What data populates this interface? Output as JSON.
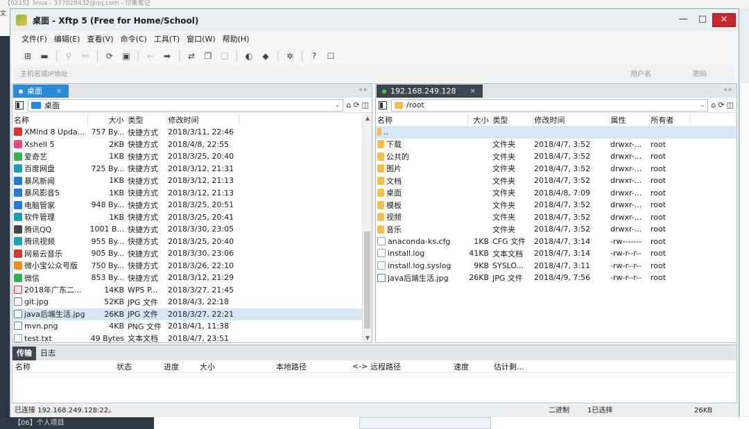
{
  "background": {
    "top_text": "【0215】linux - 377028432@qq.com - 印象笔记",
    "left_text": "文",
    "bottom_text": "【06】个人项目"
  },
  "window": {
    "title": "桌面   - Xftp 5 (Free for Home/School)",
    "controls": {
      "minimize": "—",
      "maximize": "□",
      "close": "✕"
    }
  },
  "menu": [
    "文件(F)",
    "编辑(E)",
    "查看(V)",
    "命令(C)",
    "工具(T)",
    "窗口(W)",
    "帮助(H)"
  ],
  "address": {
    "host_placeholder": "主机名或IP地址",
    "user_placeholder": "用户名",
    "password_placeholder": "密码"
  },
  "left_pane": {
    "tab_label": "桌面",
    "path": "桌面",
    "columns": [
      "名称",
      "大小",
      "类型",
      "修改时间"
    ],
    "rows": [
      {
        "name": "XMind 8 Upda...",
        "size": "757 By...",
        "type": "快捷方式",
        "time": "2018/3/11, 22:46",
        "icon": "red"
      },
      {
        "name": "Xshell 5",
        "size": "2KB",
        "type": "快捷方式",
        "time": "2018/4/8, 22:55",
        "icon": "pink"
      },
      {
        "name": "爱奇艺",
        "size": "1KB",
        "type": "快捷方式",
        "time": "2018/3/25, 20:40",
        "icon": "green"
      },
      {
        "name": "百度网盘",
        "size": "725 By...",
        "type": "快捷方式",
        "time": "2018/3/12, 21:31",
        "icon": "teal"
      },
      {
        "name": "暴风新闻",
        "size": "1KB",
        "type": "快捷方式",
        "time": "2018/3/12, 21:13",
        "icon": "blue"
      },
      {
        "name": "暴风影音5",
        "size": "1KB",
        "type": "快捷方式",
        "time": "2018/3/12, 21:13",
        "icon": "blue"
      },
      {
        "name": "电脑管家",
        "size": "948 By...",
        "type": "快捷方式",
        "time": "2018/3/25, 20:51",
        "icon": "blue"
      },
      {
        "name": "软件管理",
        "size": "1KB",
        "type": "快捷方式",
        "time": "2018/3/25, 20:41",
        "icon": "teal"
      },
      {
        "name": "腾讯QQ",
        "size": "1001 B...",
        "type": "快捷方式",
        "time": "2018/3/30, 23:05",
        "icon": "dark"
      },
      {
        "name": "腾讯视频",
        "size": "955 By...",
        "type": "快捷方式",
        "time": "2018/3/25, 20:40",
        "icon": "teal"
      },
      {
        "name": "网易云音乐",
        "size": "905 By...",
        "type": "快捷方式",
        "time": "2018/3/30, 23:06",
        "icon": "red"
      },
      {
        "name": "微小宝公众号版",
        "size": "750 By...",
        "type": "快捷方式",
        "time": "2018/3/26, 22:10",
        "icon": "orange"
      },
      {
        "name": "微信",
        "size": "853 By...",
        "type": "快捷方式",
        "time": "2018/3/12, 21:29",
        "icon": "green"
      },
      {
        "name": "2018年广东二...",
        "size": "14KB",
        "type": "WPS P...",
        "time": "2018/3/27, 21:45",
        "icon": "wps"
      },
      {
        "name": "git.jpg",
        "size": "52KB",
        "type": "JPG 文件",
        "time": "2018/4/3, 22:18",
        "icon": "img"
      },
      {
        "name": "java后端生活.jpg",
        "size": "26KB",
        "type": "JPG 文件",
        "time": "2018/3/27, 22:21",
        "icon": "img",
        "selected": true
      },
      {
        "name": "mvn.png",
        "size": "4KB",
        "type": "PNG 文件",
        "time": "2018/4/1, 11:38",
        "icon": "img"
      },
      {
        "name": "test.txt",
        "size": "49 Bytes",
        "type": "文本文档",
        "time": "2018/4/7, 23:51",
        "icon": "doc"
      }
    ]
  },
  "right_pane": {
    "tab_label": "192.168.249.128",
    "path": "/root",
    "columns": [
      "名称",
      "大小",
      "类型",
      "修改时间",
      "属性",
      "所有者"
    ],
    "rows": [
      {
        "name": "..",
        "size": "",
        "type": "",
        "time": "",
        "attr": "",
        "owner": "",
        "icon": "up",
        "selected": true
      },
      {
        "name": "下载",
        "size": "",
        "type": "文件夹",
        "time": "2018/4/7, 3:52",
        "attr": "drwxr-...",
        "owner": "root",
        "icon": "folder"
      },
      {
        "name": "公共的",
        "size": "",
        "type": "文件夹",
        "time": "2018/4/7, 3:52",
        "attr": "drwxr-...",
        "owner": "root",
        "icon": "folder"
      },
      {
        "name": "图片",
        "size": "",
        "type": "文件夹",
        "time": "2018/4/7, 3:52",
        "attr": "drwxr-...",
        "owner": "root",
        "icon": "folder"
      },
      {
        "name": "文档",
        "size": "",
        "type": "文件夹",
        "time": "2018/4/7, 3:52",
        "attr": "drwxr-...",
        "owner": "root",
        "icon": "folder"
      },
      {
        "name": "桌面",
        "size": "",
        "type": "文件夹",
        "time": "2018/4/8, 7:09",
        "attr": "drwxr-...",
        "owner": "root",
        "icon": "folder"
      },
      {
        "name": "模板",
        "size": "",
        "type": "文件夹",
        "time": "2018/4/7, 3:52",
        "attr": "drwxr-...",
        "owner": "root",
        "icon": "folder"
      },
      {
        "name": "视频",
        "size": "",
        "type": "文件夹",
        "time": "2018/4/7, 3:52",
        "attr": "drwxr-...",
        "owner": "root",
        "icon": "folder"
      },
      {
        "name": "音乐",
        "size": "",
        "type": "文件夹",
        "time": "2018/4/7, 3:52",
        "attr": "drwxr-...",
        "owner": "root",
        "icon": "folder"
      },
      {
        "name": "anaconda-ks.cfg",
        "size": "1KB",
        "type": "CFG 文件",
        "time": "2018/4/7, 3:14",
        "attr": "-rw-------",
        "owner": "root",
        "icon": "doc"
      },
      {
        "name": "install.log",
        "size": "41KB",
        "type": "文本文档",
        "time": "2018/4/7, 3:14",
        "attr": "-rw-r--r--",
        "owner": "root",
        "icon": "doc"
      },
      {
        "name": "install.log.syslog",
        "size": "9KB",
        "type": "SYSLO...",
        "time": "2018/4/7, 3:11",
        "attr": "-rw-r--r--",
        "owner": "root",
        "icon": "doc"
      },
      {
        "name": "java后端生活.jpg",
        "size": "26KB",
        "type": "JPG 文件",
        "time": "2018/4/9, 7:56",
        "attr": "-rw-r--r--",
        "owner": "root",
        "icon": "img"
      }
    ]
  },
  "transfer": {
    "tabs": [
      "传输",
      "日志"
    ],
    "columns": [
      "名称",
      "状态",
      "进度",
      "大小",
      "本地路径",
      "<->",
      "远程路径",
      "速度",
      "估计剩..."
    ]
  },
  "status": {
    "connection": "已连接 192.168.249.128:22。",
    "mode": "二进制",
    "selection": "1已选择",
    "size": "26KB"
  },
  "colors": {
    "accent": "#2a8bd8",
    "highlight_border": "#e53935",
    "selection": "#d7e6f5"
  }
}
